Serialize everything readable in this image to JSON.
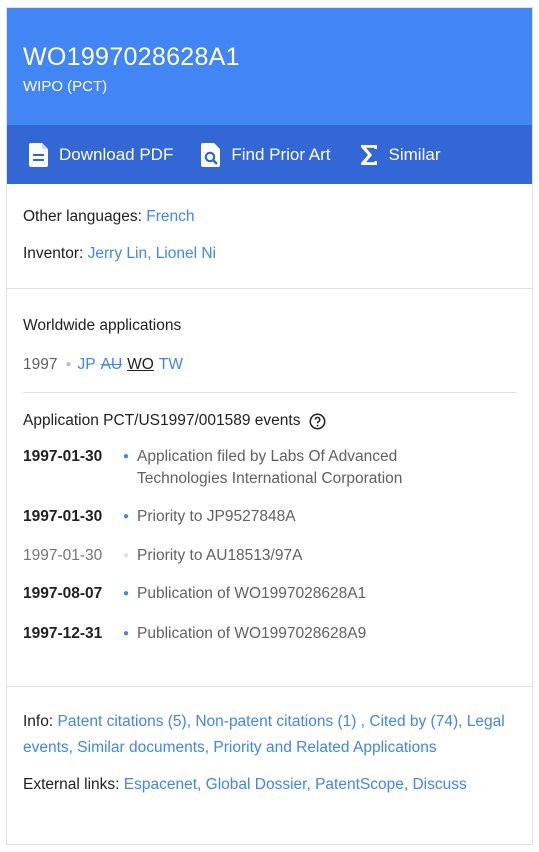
{
  "header": {
    "publication_number": "WO1997028628A1",
    "office": "WIPO (PCT)"
  },
  "toolbar": {
    "download_label": "Download PDF",
    "prior_art_label": "Find Prior Art",
    "similar_label": "Similar",
    "colors": {
      "header": "#4285f4",
      "toolbar": "#3367d6"
    }
  },
  "meta": {
    "other_languages_label": "Other languages:",
    "other_languages_value": "French",
    "inventor_label": "Inventor:",
    "inventors": [
      "Jerry Lin",
      "Lionel Ni"
    ]
  },
  "worldwide": {
    "title": "Worldwide applications",
    "year": "1997",
    "countries": [
      "JP",
      "AU",
      "WO",
      "TW"
    ]
  },
  "events": {
    "title": "Application PCT/US1997/001589 events",
    "items": [
      {
        "date": "1997-01-30",
        "description": "Application filed by Labs Of Advanced Technologies International Corporation"
      },
      {
        "date": "1997-01-30",
        "description": "Priority to JP9527848A"
      },
      {
        "date": "1997-01-30",
        "description": "Priority to AU18513/97A"
      },
      {
        "date": "1997-08-07",
        "description": "Publication of WO1997028628A1"
      },
      {
        "date": "1997-12-31",
        "description": "Publication of WO1997028628A9"
      }
    ]
  },
  "info": {
    "label": "Info:",
    "links": [
      "Patent citations (5)",
      "Non-patent citations (1)",
      "Cited by (74)",
      "Legal events",
      "Similar documents",
      "Priority and Related Applications"
    ]
  },
  "external": {
    "label": "External links:",
    "links": [
      "Espacenet",
      "Global Dossier",
      "PatentScope",
      "Discuss"
    ]
  }
}
